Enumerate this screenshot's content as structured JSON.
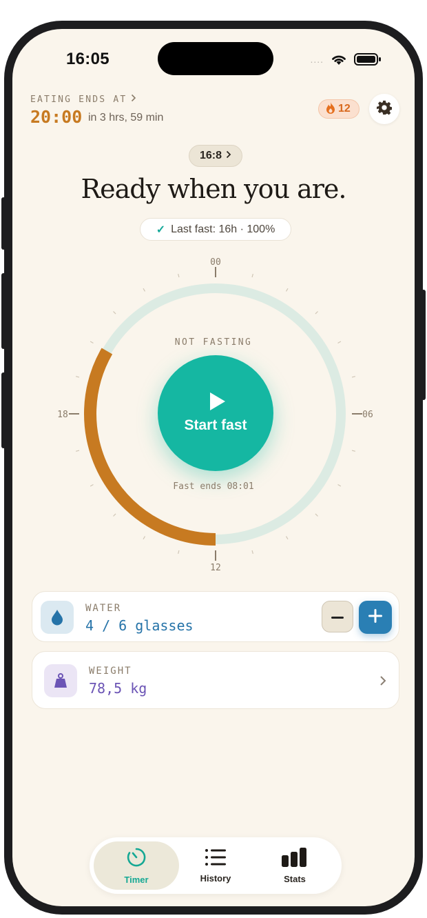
{
  "status_bar": {
    "time": "16:05",
    "signal": "...."
  },
  "header": {
    "eating_label": "EATING ENDS AT",
    "eating_time": "20:00",
    "eating_remaining": "in 3 hrs, 59 min",
    "streak_count": "12"
  },
  "plan": {
    "ratio": "16:8"
  },
  "headline": "Ready when you are.",
  "last_fast": "Last fast: 16h · 100%",
  "dial": {
    "label_top": "00",
    "label_right": "06",
    "label_bottom": "12",
    "label_left": "18",
    "status": "NOT FASTING",
    "start_label": "Start fast",
    "fast_ends": "Fast ends 08:01",
    "eating_arc_hours": [
      12,
      20
    ],
    "colors": {
      "track": "#dcebe3",
      "eating": "#c77a21",
      "accent": "#15b7a2"
    }
  },
  "water": {
    "label": "WATER",
    "value": "4 / 6 glasses",
    "current": 4,
    "goal": 6
  },
  "weight": {
    "label": "WEIGHT",
    "value": "78,5 kg"
  },
  "tabs": [
    {
      "label": "Timer",
      "icon": "timer-icon",
      "active": true
    },
    {
      "label": "History",
      "icon": "list-icon",
      "active": false
    },
    {
      "label": "Stats",
      "icon": "stats-icon",
      "active": false
    }
  ]
}
